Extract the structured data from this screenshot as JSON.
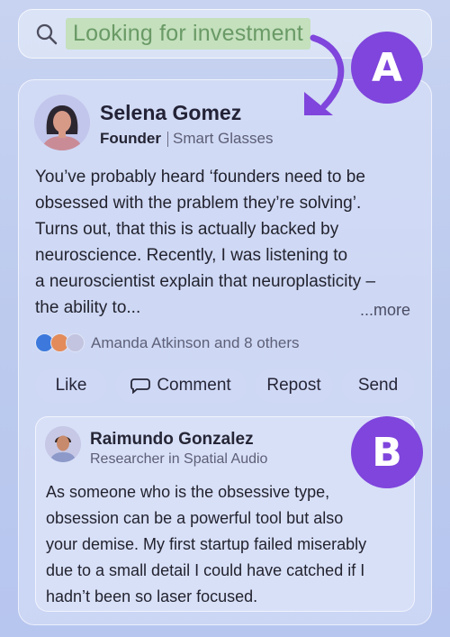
{
  "search": {
    "query": "Looking for investment"
  },
  "annotations": {
    "badge_a": "A",
    "badge_b": "B"
  },
  "post": {
    "author": {
      "name": "Selena Gomez",
      "role": "Founder",
      "company": "Smart Glasses"
    },
    "body_lines": [
      "You’ve probably heard ‘founders need to be",
      "obsessed with the prablem they’re solving’.",
      "Turns out, that this is actually backed by",
      "neuroscience. Recently, I was listening to",
      "a neuroscientist explain that neuroplasticity –",
      "the ability to..."
    ],
    "more_label": "...more",
    "reactions": {
      "text": "Amanda Atkinson and  8 others"
    },
    "actions": {
      "like": "Like",
      "comment": "Comment",
      "repost": "Repost",
      "send": "Send"
    }
  },
  "reply": {
    "author": {
      "name": "Raimundo Gonzalez",
      "headline": "Researcher in Spatial Audio"
    },
    "body_lines": [
      "As someone who is the obsessive type,",
      "obsession can be a powerful tool but also",
      "your demise. My first startup failed miserably",
      "due to a small detail I could have catched if I",
      "hadn’t been so laser focused."
    ]
  },
  "colors": {
    "accent": "#7f45dc",
    "highlight": "#c4e0bd"
  }
}
